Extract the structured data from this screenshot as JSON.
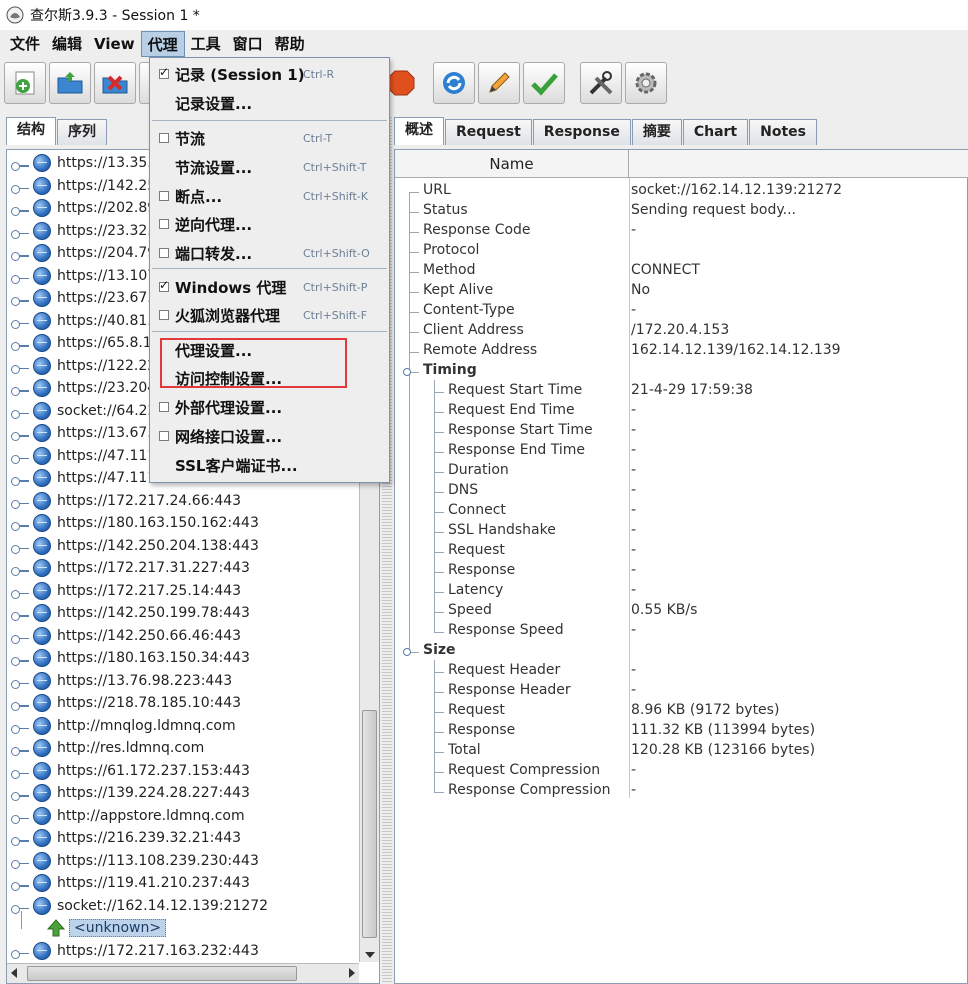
{
  "window": {
    "title": "查尔斯3.9.3 - Session 1 *"
  },
  "menubar": {
    "items": [
      "文件",
      "编辑",
      "View",
      "代理",
      "工具",
      "窗口",
      "帮助"
    ],
    "active": "代理"
  },
  "toolbar": {
    "buttons": [
      "add-icon",
      "open-icon",
      "delete-icon",
      "stop-record-icon",
      "refresh-icon",
      "edit-icon",
      "check-icon",
      "tools-icon",
      "settings-icon"
    ]
  },
  "left": {
    "tabs": [
      "结构",
      "序列"
    ],
    "tree": [
      "https://13.35.",
      "https://142.25",
      "https://202.89",
      "https://23.32.",
      "https://204.79",
      "https://13.107",
      "https://23.67.",
      "https://40.81.",
      "https://65.8.1",
      "https://122.22",
      "https://23.204",
      "socket://64.22",
      "https://13.67.",
      "https://47.111",
      "https://47.111",
      "https://172.217.24.66:443",
      "https://180.163.150.162:443",
      "https://142.250.204.138:443",
      "https://172.217.31.227:443",
      "https://172.217.25.14:443",
      "https://142.250.199.78:443",
      "https://142.250.66.46:443",
      "https://180.163.150.34:443",
      "https://13.76.98.223:443",
      "https://218.78.185.10:443",
      "http://mnqlog.ldmnq.com",
      "http://res.ldmnq.com",
      "https://61.172.237.153:443",
      "https://139.224.28.227:443",
      "http://appstore.ldmnq.com",
      "https://216.239.32.21:443",
      "https://113.108.239.230:443",
      "https://119.41.210.237:443",
      "socket://162.14.12.139:21272"
    ],
    "child_unknown": "<unknown>",
    "last_row": "https://172.217.163.232:443",
    "partial_row": "ɹ"
  },
  "right": {
    "tabs": [
      "概述",
      "Request",
      "Response",
      "摘要",
      "Chart",
      "Notes"
    ],
    "header_name": "Name",
    "rows": [
      {
        "name": "URL",
        "value": "socket://162.14.12.139:21272"
      },
      {
        "name": "Status",
        "value": "Sending request body..."
      },
      {
        "name": "Response Code",
        "value": "-"
      },
      {
        "name": "Protocol",
        "value": ""
      },
      {
        "name": "Method",
        "value": "CONNECT"
      },
      {
        "name": "Kept Alive",
        "value": "No"
      },
      {
        "name": "Content-Type",
        "value": "-"
      },
      {
        "name": "Client Address",
        "value": "/172.20.4.153"
      },
      {
        "name": "Remote Address",
        "value": "162.14.12.139/162.14.12.139"
      }
    ],
    "timing_label": "Timing",
    "timing_rows": [
      {
        "name": "Request Start Time",
        "value": "21-4-29 17:59:38"
      },
      {
        "name": "Request End Time",
        "value": "-"
      },
      {
        "name": "Response Start Time",
        "value": "-"
      },
      {
        "name": "Response End Time",
        "value": "-"
      },
      {
        "name": "Duration",
        "value": "-"
      },
      {
        "name": "DNS",
        "value": "-"
      },
      {
        "name": "Connect",
        "value": "-"
      },
      {
        "name": "SSL Handshake",
        "value": "-"
      },
      {
        "name": "Request",
        "value": "-"
      },
      {
        "name": "Response",
        "value": "-"
      },
      {
        "name": "Latency",
        "value": "-"
      },
      {
        "name": "Speed",
        "value": "0.55 KB/s"
      },
      {
        "name": "Response Speed",
        "value": "-"
      }
    ],
    "size_label": "Size",
    "size_rows": [
      {
        "name": "Request Header",
        "value": "-"
      },
      {
        "name": "Response Header",
        "value": "-"
      },
      {
        "name": "Request",
        "value": "8.96 KB (9172 bytes)"
      },
      {
        "name": "Response",
        "value": "111.32 KB (113994 bytes)"
      },
      {
        "name": "Total",
        "value": "120.28 KB (123166 bytes)"
      },
      {
        "name": "Request Compression",
        "value": "-"
      },
      {
        "name": "Response Compression",
        "value": "-"
      }
    ]
  },
  "proxy_menu": {
    "items": [
      {
        "label": "记录 (Session 1)",
        "accel": "Ctrl-R",
        "check": true
      },
      {
        "label": "记录设置...",
        "accel": "",
        "check": null
      },
      {
        "label": "节流",
        "accel": "Ctrl-T",
        "check": false
      },
      {
        "label": "节流设置...",
        "accel": "Ctrl+Shift-T",
        "check": null
      },
      {
        "label": "断点...",
        "accel": "Ctrl+Shift-K",
        "check": false
      },
      {
        "label": "逆向代理...",
        "accel": "",
        "check": false
      },
      {
        "label": "端口转发...",
        "accel": "Ctrl+Shift-O",
        "check": false
      },
      {
        "label": "Windows 代理",
        "accel": "Ctrl+Shift-P",
        "check": true
      },
      {
        "label": "火狐浏览器代理",
        "accel": "Ctrl+Shift-F",
        "check": false
      },
      {
        "label": "代理设置...",
        "accel": "",
        "check": null
      },
      {
        "label": "访问控制设置...",
        "accel": "",
        "check": null
      },
      {
        "label": "外部代理设置...",
        "accel": "",
        "check": false
      },
      {
        "label": "网络接口设置...",
        "accel": "",
        "check": false
      },
      {
        "label": "SSL客户端证书...",
        "accel": "",
        "check": null
      }
    ]
  },
  "colors": {
    "highlight_box": "#e03a3a",
    "menu_active": "#b8cfe5",
    "selection": "#bcd3ea"
  }
}
